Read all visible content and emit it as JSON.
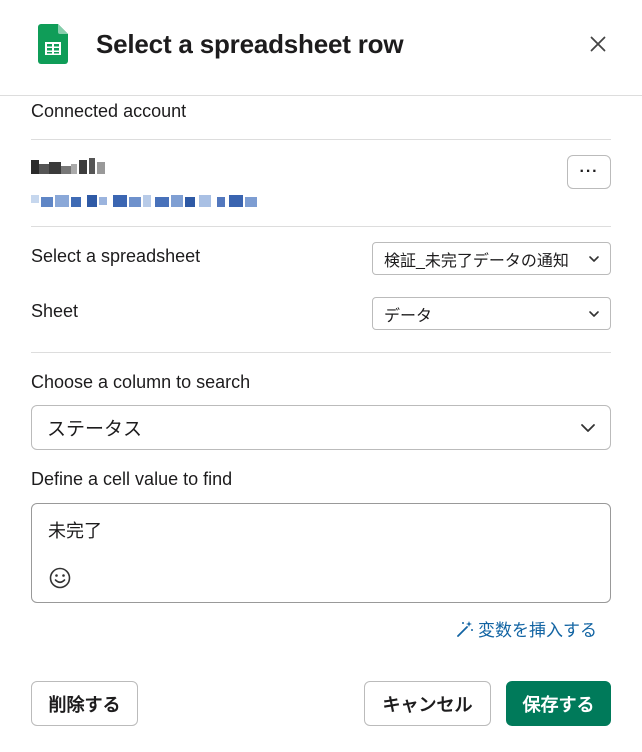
{
  "header": {
    "title": "Select a spreadsheet row",
    "app_icon": "google-sheets-icon",
    "close_icon": "close-icon"
  },
  "account": {
    "label": "Connected account",
    "name": "",
    "email": "",
    "more_label": "···"
  },
  "spreadsheet": {
    "label": "Select a spreadsheet",
    "selected": "検証_未完了データの通知"
  },
  "sheet": {
    "label": "Sheet",
    "selected": "データ"
  },
  "column": {
    "label": "Choose a column to search",
    "selected": "ステータス"
  },
  "cell_value": {
    "label": "Define a cell value to find",
    "value": "未完了",
    "emoji_icon": "emoji-smile-icon"
  },
  "insert_variable": {
    "label": "変数を挿入する",
    "icon": "magic-wand-icon"
  },
  "footer": {
    "delete_label": "削除する",
    "cancel_label": "キャンセル",
    "save_label": "保存する"
  },
  "colors": {
    "primary_green": "#007a5a",
    "link_blue": "#1264a3",
    "sheets_green": "#0f9d58",
    "text": "#1d1c1d",
    "border": "#bbbbbb"
  }
}
